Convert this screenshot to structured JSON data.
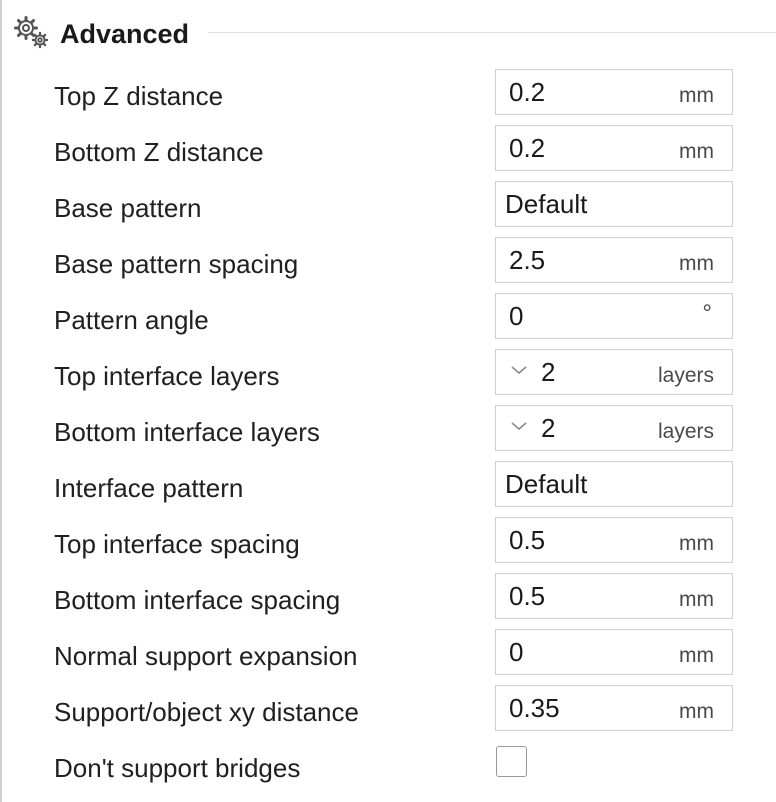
{
  "section": {
    "title": "Advanced",
    "icon": "gear-icon"
  },
  "rows": [
    {
      "label": "Top Z distance",
      "value": "0.2",
      "unit": "mm"
    },
    {
      "label": "Bottom Z distance",
      "value": "0.2",
      "unit": "mm"
    },
    {
      "label": "Base pattern",
      "value": "Default"
    },
    {
      "label": "Base pattern spacing",
      "value": "2.5",
      "unit": "mm"
    },
    {
      "label": "Pattern angle",
      "value": "0",
      "unit": "°"
    },
    {
      "label": "Top interface layers",
      "value": "2",
      "unit": "layers"
    },
    {
      "label": "Bottom interface layers",
      "value": "2",
      "unit": "layers"
    },
    {
      "label": "Interface pattern",
      "value": "Default"
    },
    {
      "label": "Top interface spacing",
      "value": "0.5",
      "unit": "mm"
    },
    {
      "label": "Bottom interface spacing",
      "value": "0.5",
      "unit": "mm"
    },
    {
      "label": "Normal support expansion",
      "value": "0",
      "unit": "mm"
    },
    {
      "label": "Support/object xy distance",
      "value": "0.35",
      "unit": "mm"
    },
    {
      "label": "Don't support bridges",
      "checked": false
    }
  ]
}
